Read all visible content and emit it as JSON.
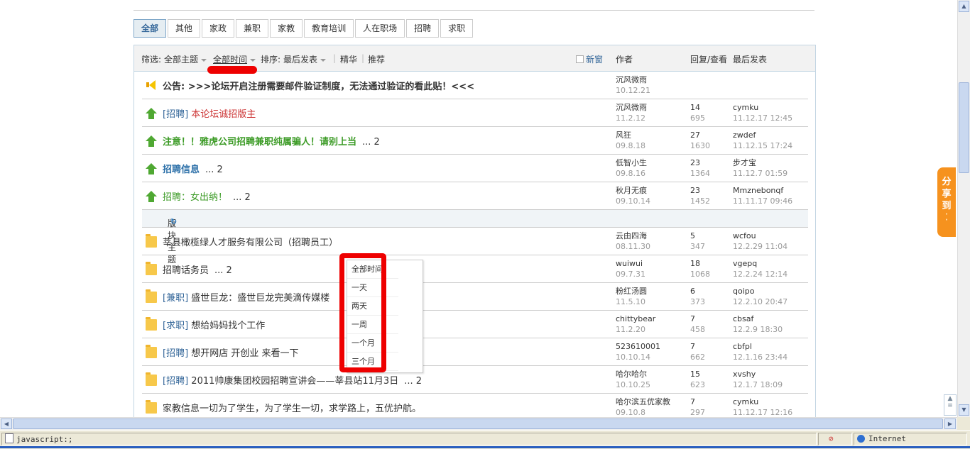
{
  "category_tabs": [
    "全部",
    "其他",
    "家政",
    "兼职",
    "家教",
    "教育培训",
    "人在职场",
    "招聘",
    "求职"
  ],
  "filter_bar": {
    "filter_label": "筛选:",
    "topic_filter": "全部主题",
    "time_filter": "全部时间",
    "sort_label": "排序:",
    "sort_value": "最后发表",
    "digest": "精华",
    "recommend": "推荐",
    "new_window": "新窗",
    "col_author": "作者",
    "col_replies": "回复/查看",
    "col_last": "最后发表"
  },
  "announcement": {
    "label": "公告:",
    "text": ">>>论坛开启注册需要邮件验证制度，无法通过验证的看此贴！<<<",
    "author": "沉风微雨",
    "date": "10.12.21"
  },
  "sticky_threads": [
    {
      "tag": "[招聘]",
      "title": "本论坛诚招版主",
      "pages": "",
      "author": "沉风微雨",
      "date": "11.2.12",
      "replies": "14",
      "views": "695",
      "last_user": "cymku",
      "last_time": "11.12.17 12:45"
    },
    {
      "tag": "",
      "title": "注意！！雅虎公司招聘兼职纯属骗人！请别上当",
      "pages": "... 2",
      "author": "风狂",
      "date": "09.8.18",
      "replies": "27",
      "views": "1630",
      "last_user": "zwdef",
      "last_time": "11.12.15 17:24"
    },
    {
      "tag": "",
      "title": "招聘信息",
      "pages": "... 2",
      "author": "低智小生",
      "date": "09.8.16",
      "replies": "23",
      "views": "1364",
      "last_user": "步才宝",
      "last_time": "11.12.7 01:59"
    },
    {
      "tag": "",
      "title": "招聘：女出纳！",
      "pages": "... 2",
      "author": "秋月无痕",
      "date": "09.10.14",
      "replies": "23",
      "views": "1452",
      "last_user": "Mmznebonqf",
      "last_time": "11.11.17 09:46"
    }
  ],
  "section_label": "版块主题",
  "threads": [
    {
      "tag": "",
      "title": "莘县橄榄绿人才服务有限公司（招聘员工）",
      "pages": "",
      "author": "云由四海",
      "date": "08.11.30",
      "replies": "5",
      "views": "347",
      "last_user": "wcfou",
      "last_time": "12.2.29 11:04"
    },
    {
      "tag": "",
      "title": "招聘话务员",
      "pages": "... 2",
      "author": "wuiwui",
      "date": "09.7.31",
      "replies": "18",
      "views": "1068",
      "last_user": "vgepq",
      "last_time": "12.2.24 12:14"
    },
    {
      "tag": "[兼职]",
      "title": "盛世巨龙：盛世巨龙完美滴传媒楼",
      "pages": "",
      "author": "粉红汤圆",
      "date": "11.5.10",
      "replies": "6",
      "views": "373",
      "last_user": "qoipo",
      "last_time": "12.2.10 20:47"
    },
    {
      "tag": "[求职]",
      "title": "想给妈妈找个工作",
      "pages": "",
      "author": "chittybear",
      "date": "11.2.20",
      "replies": "7",
      "views": "458",
      "last_user": "cbsaf",
      "last_time": "12.2.9 18:30"
    },
    {
      "tag": "[招聘]",
      "title": "想开网店 开创业 来看一下",
      "pages": "",
      "author": "523610001",
      "date": "10.10.14",
      "replies": "7",
      "views": "662",
      "last_user": "cbfpl",
      "last_time": "12.1.16 23:44"
    },
    {
      "tag": "[招聘]",
      "title": "2011帅康集团校园招聘宣讲会——莘县站11月3日",
      "pages": "... 2",
      "author": "哈尔哈尔",
      "date": "10.10.25",
      "replies": "15",
      "views": "623",
      "last_user": "xvshy",
      "last_time": "12.1.7 18:09"
    },
    {
      "tag": "",
      "title": "家教信息一切为了学生，为了学生一切，求学路上，五优护航。",
      "pages": "",
      "author": "哈尔滨五优家教",
      "date": "09.10.8",
      "replies": "7",
      "views": "297",
      "last_user": "cymku",
      "last_time": "11.12.17 12:16"
    }
  ],
  "time_dropdown": [
    "全部时间",
    "一天",
    "两天",
    "一周",
    "一个月",
    "三个月"
  ],
  "share_button": [
    "分",
    "享",
    "到"
  ],
  "statusbar": {
    "url": "javascript:;",
    "zone": "Internet"
  },
  "colors": {
    "accent": "#336699",
    "sticky_green": "#4fa832",
    "highlight_red": "#cc3333",
    "bold_green": "#3c9b26",
    "bold_blue": "#2b6fa8",
    "share_orange": "#f6921e",
    "annotation_red": "#ee0000"
  },
  "icons": {
    "announcement": "megaphone-icon",
    "sticky": "sticky-arrow-icon",
    "thread": "folder-icon",
    "refresh": "refresh-icon",
    "page": "page-icon",
    "zone": "globe-icon"
  }
}
